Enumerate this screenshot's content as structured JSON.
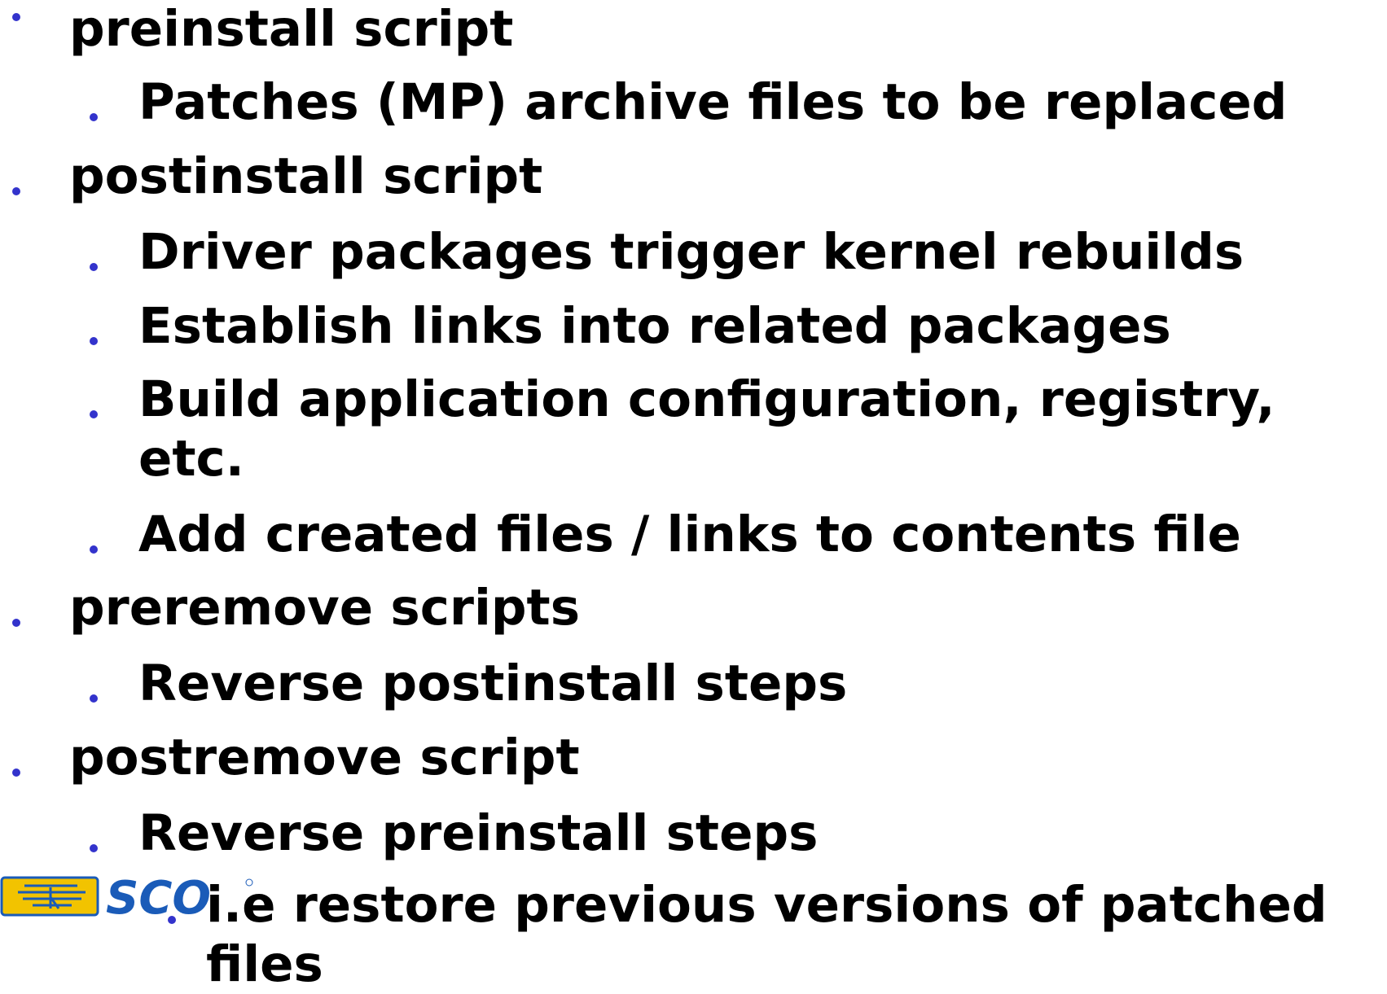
{
  "slide": {
    "bullet_color": "#3333cc",
    "items": [
      {
        "level": 1,
        "text": "preinstall script"
      },
      {
        "level": 2,
        "text": "Patches (MP) archive files to be replaced"
      },
      {
        "level": 1,
        "text": "postinstall script"
      },
      {
        "level": 2,
        "text": "Driver packages trigger kernel rebuilds"
      },
      {
        "level": 2,
        "text": "Establish links into related packages"
      },
      {
        "level": 2,
        "text": "Build application configuration, registry, etc."
      },
      {
        "level": 2,
        "text": "Add created files / links to contents file"
      },
      {
        "level": 1,
        "text": "preremove scripts"
      },
      {
        "level": 2,
        "text": "Reverse postinstall steps"
      },
      {
        "level": 1,
        "text": "postremove script"
      },
      {
        "level": 2,
        "text": "Reverse preinstall steps"
      },
      {
        "level": 3,
        "text": "i.e restore previous versions of patched files"
      }
    ]
  },
  "footer": {
    "logo_text": "SCO",
    "logo_icon": "sco-caldera-logo-icon",
    "logo_color": "#1a5bb8",
    "badge_color": "#f2c300"
  }
}
